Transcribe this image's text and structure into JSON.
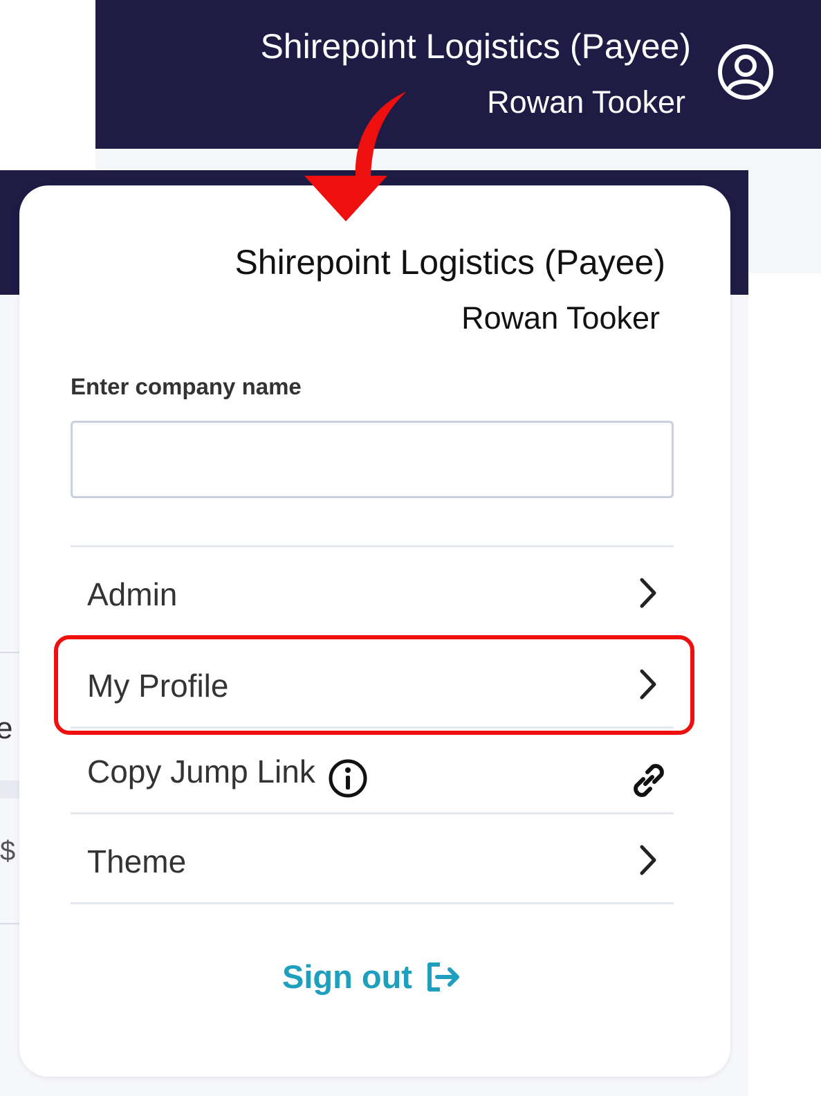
{
  "header": {
    "company_name": "Shirepoint Logistics (Payee)",
    "user_name": "Rowan Tooker",
    "avatar_icon": "user-circle-icon"
  },
  "background": {
    "partial_text": "e",
    "partial_currency": "$"
  },
  "dropdown": {
    "company_name": "Shirepoint Logistics (Payee)",
    "user_name": "Rowan Tooker",
    "search": {
      "label": "Enter company name",
      "value": "",
      "placeholder": ""
    },
    "menu": [
      {
        "label": "Admin",
        "icon": "chevron-right-icon"
      },
      {
        "label": "My Profile",
        "icon": "chevron-right-icon"
      },
      {
        "label": "Copy Jump Link",
        "info_icon": "info-icon",
        "icon": "link-icon"
      },
      {
        "label": "Theme",
        "icon": "chevron-right-icon"
      }
    ],
    "sign_out": {
      "label": "Sign out",
      "icon": "sign-out-icon"
    }
  },
  "colors": {
    "header_bg": "#1e1b45",
    "accent": "#1d9fbd",
    "annotation": "#ee0f0f"
  }
}
